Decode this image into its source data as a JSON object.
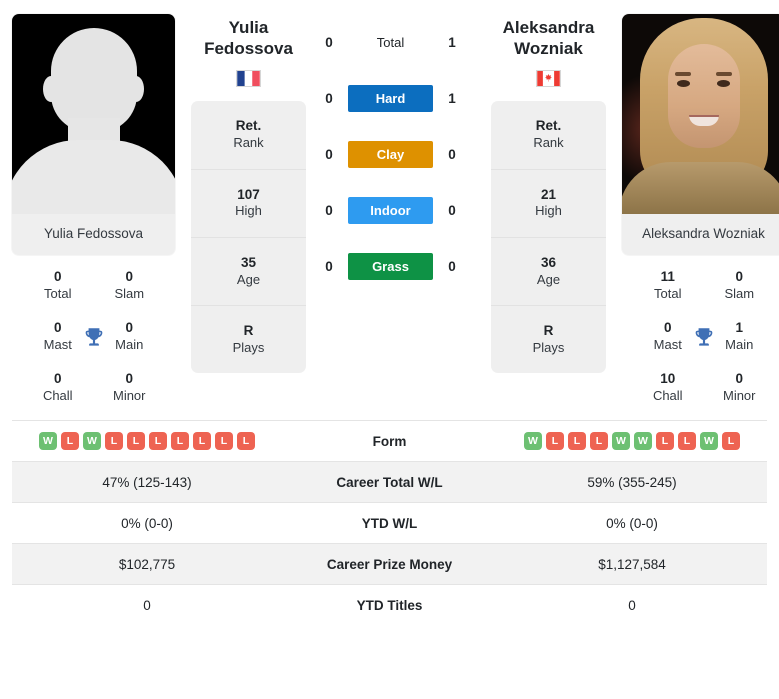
{
  "players": {
    "left": {
      "name_line1": "Yulia",
      "name_line2": "Fedossova",
      "photo_caption": "Yulia Fedossova",
      "flag": "flag-france-icon",
      "flag_name": "France",
      "photo_type": "placeholder-avatar",
      "info": [
        {
          "value": "Ret.",
          "label": "Rank"
        },
        {
          "value": "107",
          "label": "High"
        },
        {
          "value": "35",
          "label": "Age"
        },
        {
          "value": "R",
          "label": "Plays"
        }
      ],
      "titles": [
        {
          "value": "0",
          "label": "Total"
        },
        {
          "value": "0",
          "label": "Slam"
        },
        {
          "value": "0",
          "label": "Mast"
        },
        {
          "value": "0",
          "label": "Main"
        },
        {
          "value": "0",
          "label": "Chall"
        },
        {
          "value": "0",
          "label": "Minor"
        }
      ],
      "form": [
        "W",
        "L",
        "W",
        "L",
        "L",
        "L",
        "L",
        "L",
        "L",
        "L"
      ],
      "career_total_wl": "47% (125-143)",
      "ytd_wl": "0% (0-0)",
      "career_prize_money": "$102,775",
      "ytd_titles": "0"
    },
    "right": {
      "name_line1": "Aleksandra",
      "name_line2": "Wozniak",
      "photo_caption": "Aleksandra Wozniak",
      "flag": "flag-canada-icon",
      "flag_name": "Canada",
      "photo_type": "portrait-photo",
      "info": [
        {
          "value": "Ret.",
          "label": "Rank"
        },
        {
          "value": "21",
          "label": "High"
        },
        {
          "value": "36",
          "label": "Age"
        },
        {
          "value": "R",
          "label": "Plays"
        }
      ],
      "titles": [
        {
          "value": "11",
          "label": "Total"
        },
        {
          "value": "0",
          "label": "Slam"
        },
        {
          "value": "0",
          "label": "Mast"
        },
        {
          "value": "1",
          "label": "Main"
        },
        {
          "value": "10",
          "label": "Chall"
        },
        {
          "value": "0",
          "label": "Minor"
        }
      ],
      "form": [
        "W",
        "L",
        "L",
        "L",
        "W",
        "W",
        "L",
        "L",
        "W",
        "L"
      ],
      "career_total_wl": "59% (355-245)",
      "ytd_wl": "0% (0-0)",
      "career_prize_money": "$1,127,584",
      "ytd_titles": "0"
    }
  },
  "head_to_head": [
    {
      "label": "Total",
      "left": "0",
      "right": "1",
      "style": "plain",
      "color": ""
    },
    {
      "label": "Hard",
      "left": "0",
      "right": "1",
      "style": "badge",
      "color": "#0C6EBF"
    },
    {
      "label": "Clay",
      "left": "0",
      "right": "0",
      "style": "badge",
      "color": "#DE9100"
    },
    {
      "label": "Indoor",
      "left": "0",
      "right": "0",
      "style": "badge",
      "color": "#2E9BF0"
    },
    {
      "label": "Grass",
      "left": "0",
      "right": "0",
      "style": "badge",
      "color": "#0E9245"
    }
  ],
  "stats_table": [
    {
      "label": "Form",
      "left": "",
      "right": "",
      "type": "form"
    },
    {
      "label": "Career Total W/L",
      "left": "47% (125-143)",
      "right": "59% (355-245)",
      "type": "text"
    },
    {
      "label": "YTD W/L",
      "left": "0% (0-0)",
      "right": "0% (0-0)",
      "type": "text"
    },
    {
      "label": "Career Prize Money",
      "left": "$102,775",
      "right": "$1,127,584",
      "type": "text"
    },
    {
      "label": "YTD Titles",
      "left": "0",
      "right": "0",
      "type": "text"
    }
  ],
  "colors": {
    "win": "#6DC072",
    "loss": "#EE6352",
    "trophy": "#3F6FB5",
    "card_bg": "#efefef",
    "row_alt": "#f2f2f2"
  },
  "icons": {
    "trophy": "trophy-icon"
  }
}
